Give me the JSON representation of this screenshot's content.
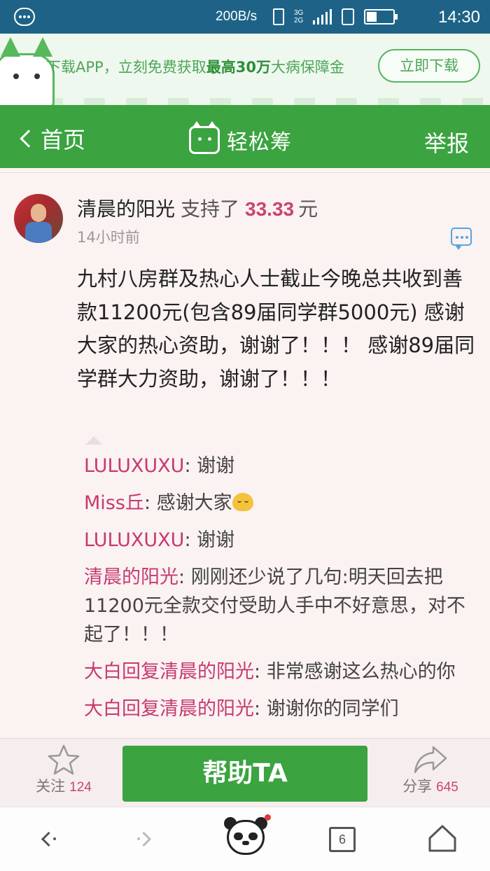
{
  "status_bar": {
    "speed": "200B/s",
    "network": "3G",
    "network_sub": "2G",
    "time": "14:30"
  },
  "banner": {
    "text_prefix": "下载APP，立刻免费获取",
    "text_highlight": "最高30万",
    "text_suffix": "大病保障金",
    "button": "立即下载",
    "accent_color": "#4ea556"
  },
  "nav": {
    "back_label": "首页",
    "logo_text": "轻松筹",
    "report_label": "举报",
    "bg_color": "#3ba340"
  },
  "post": {
    "user": "清晨的阳光",
    "verb": "支持了",
    "amount": "33.33",
    "unit": "元",
    "time": "14小时前",
    "text": "九村八房群及热心人士截止今晚总共收到善款11200元(包含89届同学群5000元) 感谢大家的热心资助，谢谢了！！！ 感谢89届同学群大力资助，谢谢了！！！"
  },
  "replies": [
    {
      "name": "LULUXUXU",
      "text": "谢谢"
    },
    {
      "name": "Miss丘",
      "text": "感谢大家",
      "emoji": "praying-hands-emoji"
    },
    {
      "name": "LULUXUXU",
      "text": "谢谢"
    },
    {
      "name": "清晨的阳光",
      "text": "刚刚还少说了几句:明天回去把11200元全款交付受助人手中不好意思，对不起了！！！"
    },
    {
      "name": "大白回复清晨的阳光",
      "text": "非常感谢这么热心的你"
    },
    {
      "name": "大白回复清晨的阳光",
      "text": "谢谢你的同学们"
    }
  ],
  "action_bar": {
    "follow_label": "关注",
    "follow_count": "124",
    "help_button": "帮助TA",
    "share_label": "分享",
    "share_count": "645"
  },
  "browser_bar": {
    "tab_count": "6"
  },
  "colors": {
    "highlight_pink": "#c94470",
    "reply_name": "#c53a70",
    "status_bar": "#1e6387"
  }
}
